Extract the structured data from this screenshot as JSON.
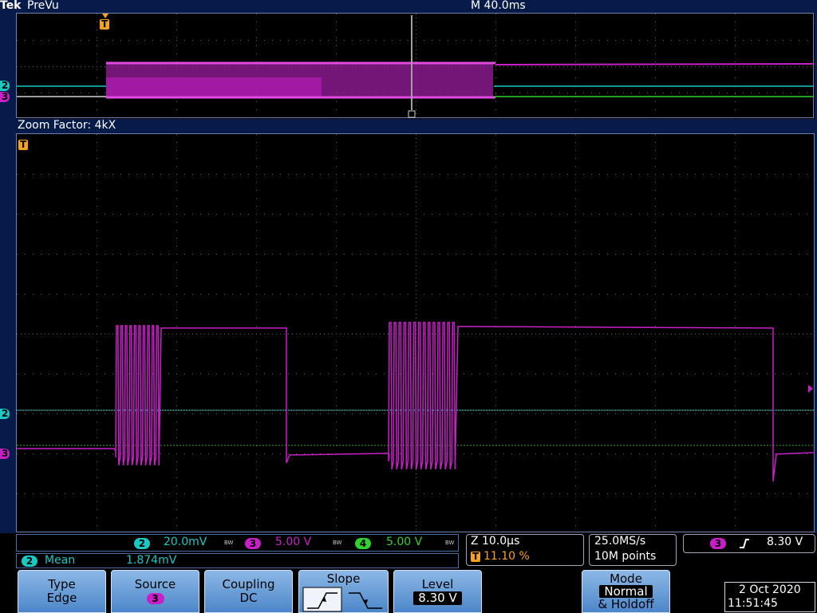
{
  "header": {
    "brand": "Tek",
    "title": "PreVu",
    "timebase": "M 40.0ms"
  },
  "zoom": {
    "label": "Zoom Factor: 4kX"
  },
  "markers": {
    "ch2": "2",
    "ch3": "3",
    "trigger": "T"
  },
  "readouts": {
    "ch2": {
      "num": "2",
      "scale": "20.0mV",
      "bw": "BW"
    },
    "ch3": {
      "num": "3",
      "scale": "5.00 V",
      "bw": "BW"
    },
    "ch4": {
      "num": "4",
      "scale": "5.00 V",
      "bw": "BW"
    },
    "measurement": {
      "num": "2",
      "label": "Mean",
      "value": "1.874mV"
    },
    "zoom_time": {
      "prefix": "Z",
      "value": "10.0µs",
      "trig_pos": "11.10 %"
    },
    "acquisition": {
      "rate": "25.0MS/s",
      "points": "10M points"
    },
    "trigger": {
      "source": "3",
      "level": "8.30 V"
    }
  },
  "menu": {
    "type": {
      "label": "Type",
      "value": "Edge"
    },
    "source": {
      "label": "Source",
      "value": "3"
    },
    "coupling": {
      "label": "Coupling",
      "value": "DC"
    },
    "slope": {
      "label": "Slope"
    },
    "level": {
      "label": "Level",
      "value": "8.30 V"
    },
    "mode": {
      "label": "Mode",
      "value": "Normal",
      "sub": "& Holdoff"
    }
  },
  "datetime": {
    "date": "2 Oct 2020",
    "time": "11:51:45"
  },
  "colors": {
    "ch2": "#19c9c4",
    "ch3": "#c81fc8",
    "ch4": "#2fd32f",
    "trigger": "#f7a21b",
    "panel": "#071b4a"
  }
}
